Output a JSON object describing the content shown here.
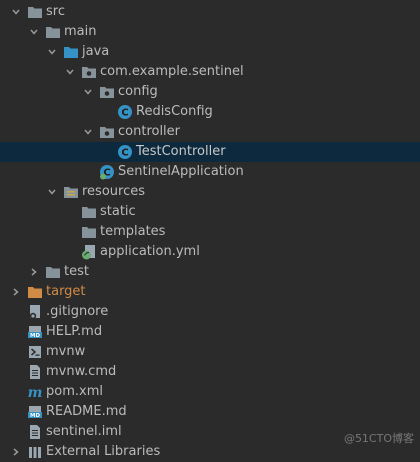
{
  "project_tree": {
    "src": "src",
    "main": "main",
    "java": "java",
    "package": "com.example.sentinel",
    "config": "config",
    "redis_config": "RedisConfig",
    "controller": "controller",
    "test_controller": "TestController",
    "sentinel_application": "SentinelApplication",
    "resources": "resources",
    "static": "static",
    "templates": "templates",
    "application_yml": "application.yml",
    "test": "test",
    "target": "target",
    "gitignore": ".gitignore",
    "help_md": "HELP.md",
    "mvnw": "mvnw",
    "mvnw_cmd": "mvnw.cmd",
    "pom_xml": "pom.xml",
    "readme_md": "README.md",
    "sentinel_iml": "sentinel.iml",
    "external_libraries": "External Libraries"
  },
  "watermark": "@51CTO博客",
  "colors": {
    "background": "#2b2b2b",
    "selected_row": "#0d293e",
    "text": "#bbbbbb",
    "excluded_folder": "#d08b45",
    "class_icon": "#3592c4",
    "folder_icon": "#87939a"
  }
}
